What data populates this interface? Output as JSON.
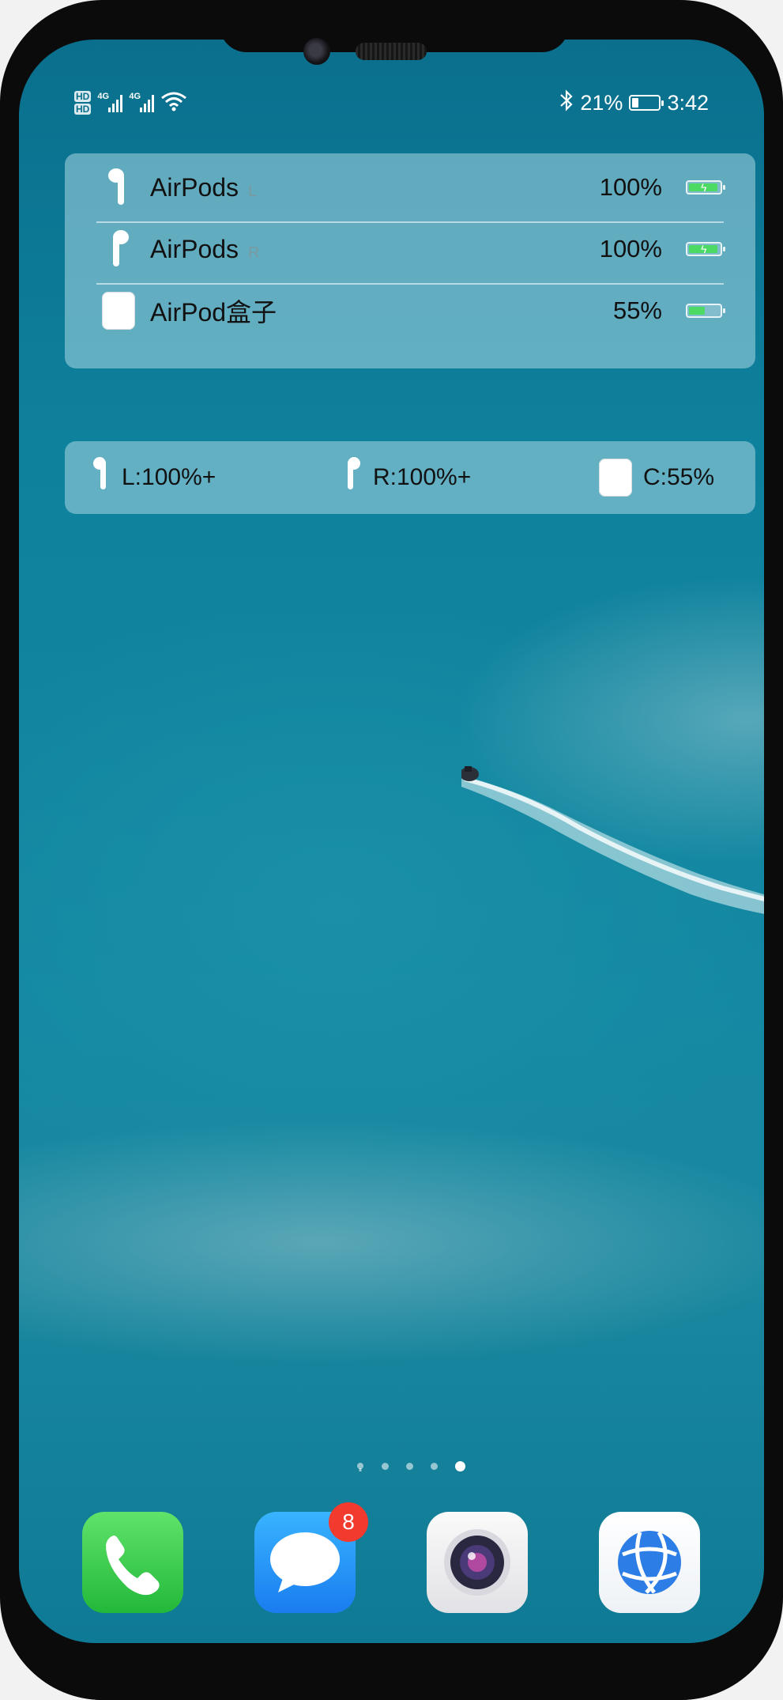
{
  "status_bar": {
    "left": {
      "hd1": "HD",
      "hd2": "HD",
      "net1": "4G",
      "net2": "4G"
    },
    "battery_percent": "21%",
    "time": "3:42"
  },
  "widget_list": {
    "rows": [
      {
        "name": "AirPods",
        "side": "L",
        "percent": "100%",
        "level": 1.0,
        "charging": true
      },
      {
        "name": "AirPods",
        "side": "R",
        "percent": "100%",
        "level": 1.0,
        "charging": true
      },
      {
        "name": "AirPod盒子",
        "side": "",
        "percent": "55%",
        "level": 0.55,
        "charging": false
      }
    ]
  },
  "widget_compact": {
    "left": "L:100%+",
    "right": "R:100%+",
    "case": "C:55%"
  },
  "home": {
    "page_count": 5,
    "active_page": 5
  },
  "dock": {
    "apps": [
      {
        "icon": "phone-icon"
      },
      {
        "icon": "messages-icon",
        "badge": "8"
      },
      {
        "icon": "camera-icon"
      },
      {
        "icon": "browser-icon"
      }
    ]
  }
}
